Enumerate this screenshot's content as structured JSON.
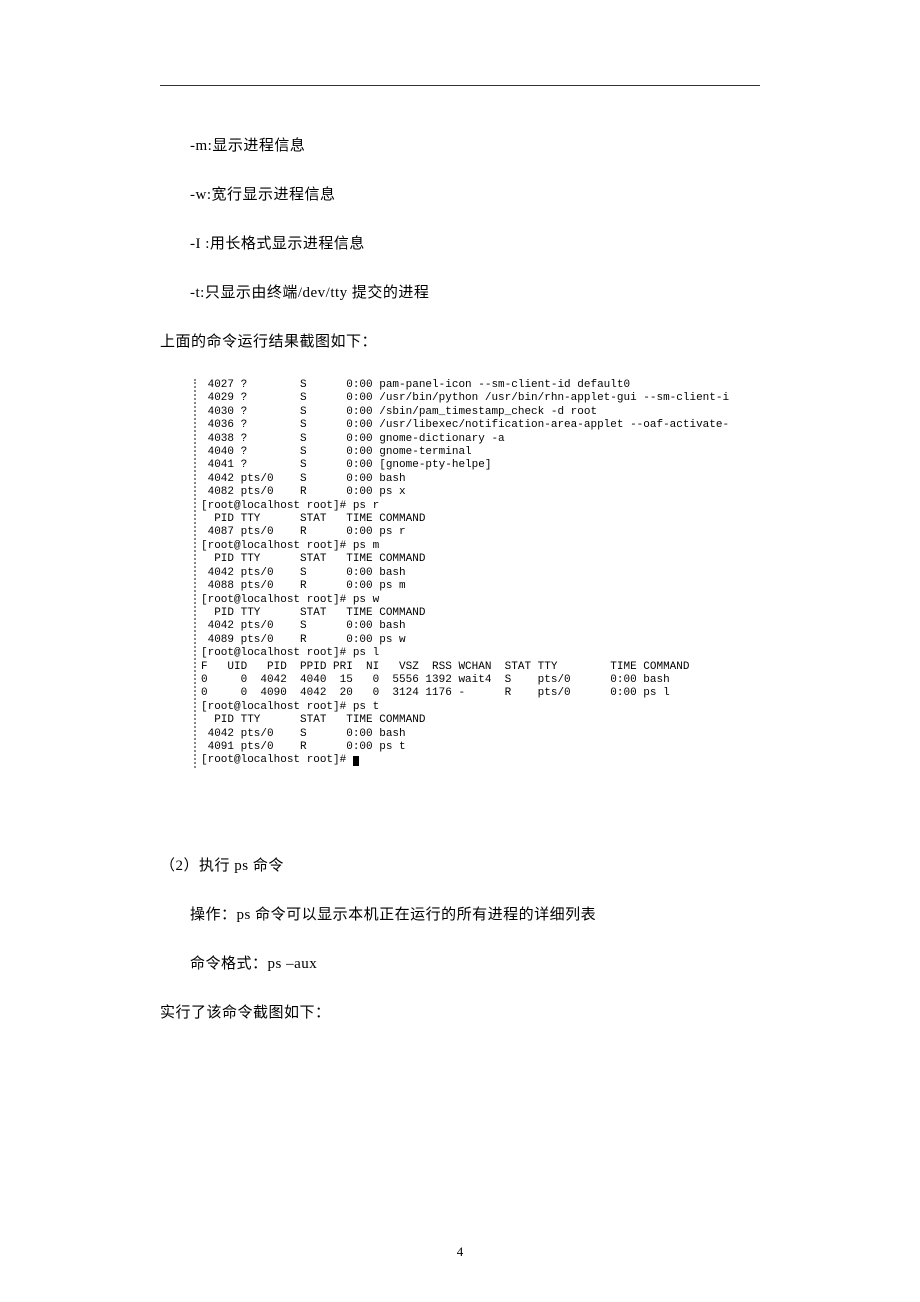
{
  "bullets": {
    "m": "-m:显示进程信息",
    "w": "-w:宽行显示进程信息",
    "l": "-I :用长格式显示进程信息",
    "t": "-t:只显示由终端/dev/tty 提交的进程"
  },
  "caption_above": "上面的命令运行结果截图如下：",
  "terminal": [
    " 4027 ?        S      0:00 pam-panel-icon --sm-client-id default0",
    " 4029 ?        S      0:00 /usr/bin/python /usr/bin/rhn-applet-gui --sm-client-i",
    " 4030 ?        S      0:00 /sbin/pam_timestamp_check -d root",
    " 4036 ?        S      0:00 /usr/libexec/notification-area-applet --oaf-activate-",
    " 4038 ?        S      0:00 gnome-dictionary -a",
    " 4040 ?        S      0:00 gnome-terminal",
    " 4041 ?        S      0:00 [gnome-pty-helpe]",
    " 4042 pts/0    S      0:00 bash",
    " 4082 pts/0    R      0:00 ps x",
    "[root@localhost root]# ps r",
    "  PID TTY      STAT   TIME COMMAND",
    " 4087 pts/0    R      0:00 ps r",
    "[root@localhost root]# ps m",
    "  PID TTY      STAT   TIME COMMAND",
    " 4042 pts/0    S      0:00 bash",
    " 4088 pts/0    R      0:00 ps m",
    "[root@localhost root]# ps w",
    "  PID TTY      STAT   TIME COMMAND",
    " 4042 pts/0    S      0:00 bash",
    " 4089 pts/0    R      0:00 ps w",
    "[root@localhost root]# ps l",
    "F   UID   PID  PPID PRI  NI   VSZ  RSS WCHAN  STAT TTY        TIME COMMAND",
    "0     0  4042  4040  15   0  5556 1392 wait4  S    pts/0      0:00 bash",
    "0     0  4090  4042  20   0  3124 1176 -      R    pts/0      0:00 ps l",
    "[root@localhost root]# ps t",
    "  PID TTY      STAT   TIME COMMAND",
    " 4042 pts/0    S      0:00 bash",
    " 4091 pts/0    R      0:00 ps t",
    "[root@localhost root]# "
  ],
  "section2": {
    "title": "（2）执行 ps 命令",
    "operation": "操作：ps 命令可以显示本机正在运行的所有进程的详细列表",
    "format": "命令格式：ps –aux",
    "caption": "实行了该命令截图如下："
  },
  "page_number": "4"
}
